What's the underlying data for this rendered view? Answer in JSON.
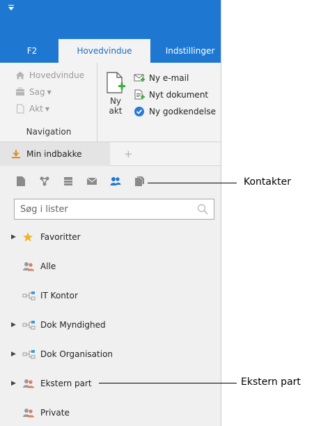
{
  "tabs": [
    {
      "label": "F2"
    },
    {
      "label": "Hovedvindue",
      "active": true
    },
    {
      "label": "Indstillinger"
    }
  ],
  "ribbon": {
    "navigation": {
      "items": [
        "Hovedvindue",
        "Sag",
        "Akt"
      ],
      "group_label": "Navigation"
    },
    "new_akt_label_1": "Ny",
    "new_akt_label_2": "akt",
    "actions": [
      "Ny e-mail",
      "Nyt dokument",
      "Ny godkendelse"
    ]
  },
  "inbox": {
    "tab_label": "Min indbakke",
    "add_tab_glyph": "+"
  },
  "toolbar_icons": [
    "document-icon",
    "workflow-icon",
    "list-icon",
    "mail-icon",
    "contacts-icon",
    "files-icon"
  ],
  "search": {
    "placeholder": "Søg i lister",
    "value": ""
  },
  "lists": [
    {
      "label": "Favoritter",
      "icon": "star-icon",
      "expandable": true
    },
    {
      "label": "Alle",
      "icon": "people-icon",
      "expandable": false
    },
    {
      "label": "IT Kontor",
      "icon": "org-unit-icon",
      "expandable": false
    },
    {
      "label": "Dok Myndighed",
      "icon": "org-unit-icon",
      "expandable": true
    },
    {
      "label": "Dok Organisation",
      "icon": "org-unit-icon",
      "expandable": true
    },
    {
      "label": "Ekstern part",
      "icon": "people-icon",
      "expandable": true
    },
    {
      "label": "Private",
      "icon": "people-icon",
      "expandable": false
    }
  ],
  "callouts": {
    "contacts": "Kontakter",
    "external": "Ekstern part"
  },
  "colors": {
    "brand": "#1e78d2",
    "ribbon_bg": "#f3f3f3",
    "panel_bg": "#f0f0f0",
    "contacts_active": "#1e78d2"
  }
}
